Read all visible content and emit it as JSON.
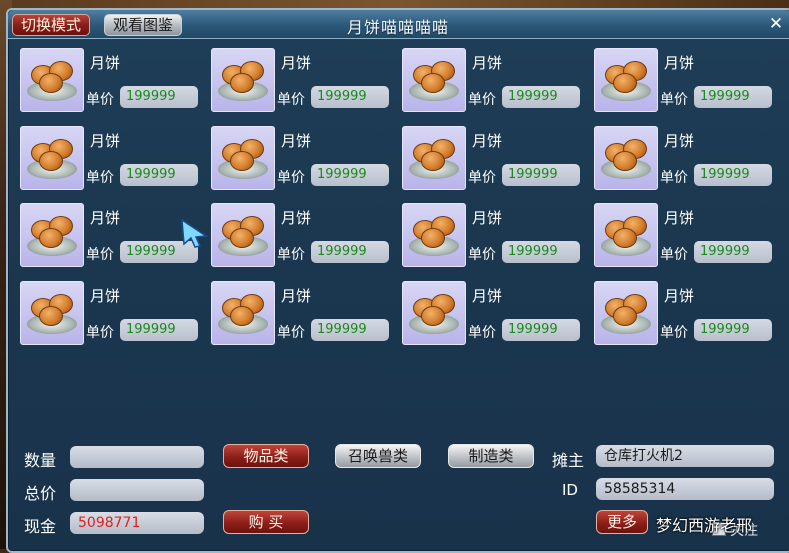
{
  "window": {
    "title": "月饼喵喵喵喵"
  },
  "toolbar": {
    "switch_mode_label": "切换模式",
    "view_catalog_label": "观看图鉴"
  },
  "close_glyph": "✕",
  "items": [
    {
      "name": "月饼",
      "price_label": "单价",
      "price": "199999"
    },
    {
      "name": "月饼",
      "price_label": "单价",
      "price": "199999"
    },
    {
      "name": "月饼",
      "price_label": "单价",
      "price": "199999"
    },
    {
      "name": "月饼",
      "price_label": "单价",
      "price": "199999"
    },
    {
      "name": "月饼",
      "price_label": "单价",
      "price": "199999"
    },
    {
      "name": "月饼",
      "price_label": "单价",
      "price": "199999"
    },
    {
      "name": "月饼",
      "price_label": "单价",
      "price": "199999"
    },
    {
      "name": "月饼",
      "price_label": "单价",
      "price": "199999"
    },
    {
      "name": "月饼",
      "price_label": "单价",
      "price": "199999"
    },
    {
      "name": "月饼",
      "price_label": "单价",
      "price": "199999"
    },
    {
      "name": "月饼",
      "price_label": "单价",
      "price": "199999"
    },
    {
      "name": "月饼",
      "price_label": "单价",
      "price": "199999"
    },
    {
      "name": "月饼",
      "price_label": "单价",
      "price": "199999"
    },
    {
      "name": "月饼",
      "price_label": "单价",
      "price": "199999"
    },
    {
      "name": "月饼",
      "price_label": "单价",
      "price": "199999"
    },
    {
      "name": "月饼",
      "price_label": "单价",
      "price": "199999"
    }
  ],
  "purchase": {
    "quantity_label": "数量",
    "quantity_value": "",
    "total_label": "总价",
    "total_value": "",
    "cash_label": "现金",
    "cash_value": "5098771",
    "buy_label": "购 买"
  },
  "categories": {
    "goods": "物品类",
    "summon": "召唤兽类",
    "craft": "制造类"
  },
  "seller": {
    "owner_label": "摊主",
    "owner_value": "仓库打火机2",
    "id_label": "ID",
    "id_value": "58585314",
    "more_label": "更多",
    "checkbox_label": "关注"
  },
  "watermark": "梦幻西游老邢",
  "colors": {
    "price_text": "#1a8a1a",
    "cash_text": "#e22020",
    "accent_red": "#8c1f19"
  }
}
